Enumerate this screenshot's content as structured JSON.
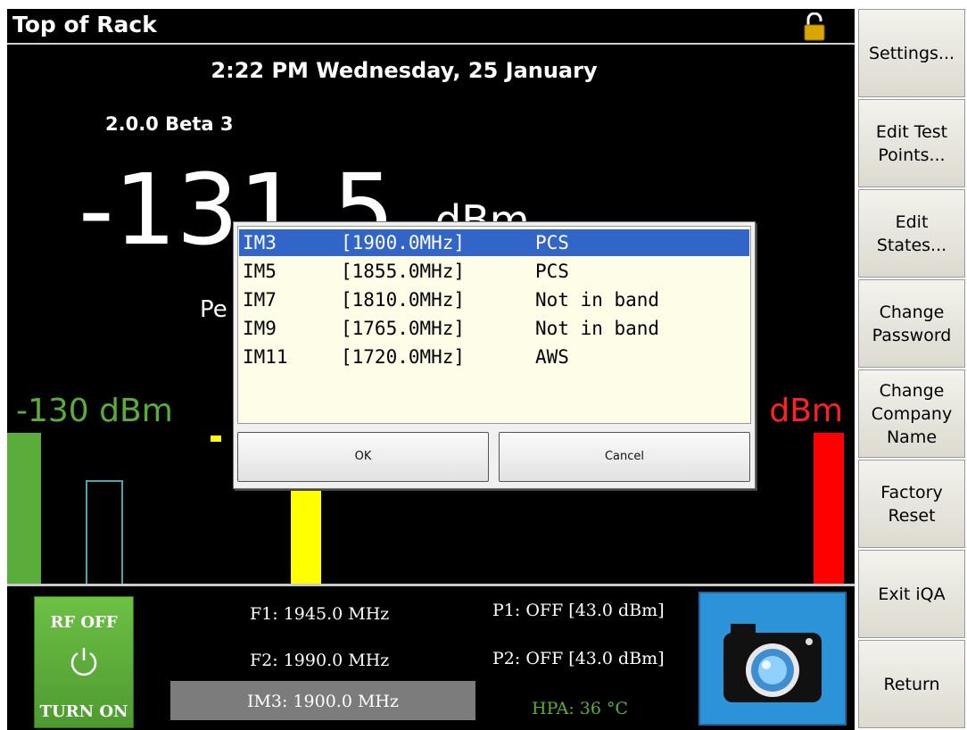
{
  "header": {
    "title": "Top of Rack"
  },
  "status": {
    "datetime": "2:22 PM Wednesday, 25 January",
    "version": "2.0.0 Beta 3",
    "reading_value": "-131.5",
    "reading_unit": "dBm",
    "peak_label_partial": "Pe",
    "min_label": "-130 dBm",
    "max_label_partial": "0 dBm"
  },
  "dialog": {
    "rows": [
      {
        "name": "IM3",
        "freq": "[1900.0MHz]",
        "band": "PCS",
        "selected": true
      },
      {
        "name": "IM5",
        "freq": "[1855.0MHz]",
        "band": "PCS",
        "selected": false
      },
      {
        "name": "IM7",
        "freq": "[1810.0MHz]",
        "band": "Not in band",
        "selected": false
      },
      {
        "name": "IM9",
        "freq": "[1765.0MHz]",
        "band": "Not in band",
        "selected": false
      },
      {
        "name": "IM11",
        "freq": "[1720.0MHz]",
        "band": "AWS",
        "selected": false
      }
    ],
    "ok_label": "OK",
    "cancel_label": "Cancel"
  },
  "bottom": {
    "rf_state": "RF OFF",
    "rf_action": "TURN ON",
    "f1": "F1: 1945.0 MHz",
    "f2": "F2: 1990.0 MHz",
    "im3": "IM3: 1900.0 MHz",
    "p1": "P1: OFF [43.0 dBm]",
    "p2": "P2: OFF [43.0 dBm]",
    "hpa": "HPA: 36 °C"
  },
  "sidebar": {
    "items": [
      {
        "label": "Settings..."
      },
      {
        "label": "Edit Test Points..."
      },
      {
        "label": "Edit States..."
      },
      {
        "label": "Change Password"
      },
      {
        "label": "Change Company Name"
      },
      {
        "label": "Factory Reset"
      },
      {
        "label": "Exit iQA"
      },
      {
        "label": "Return"
      }
    ]
  },
  "colors": {
    "green": "#5aad3a",
    "red": "#ff0000",
    "yellow": "#ffff00",
    "selection": "#3165c7",
    "camera": "#2d93d8"
  },
  "icons": {
    "lock": "padlock-icon",
    "power": "power-icon",
    "camera": "camera-icon"
  }
}
